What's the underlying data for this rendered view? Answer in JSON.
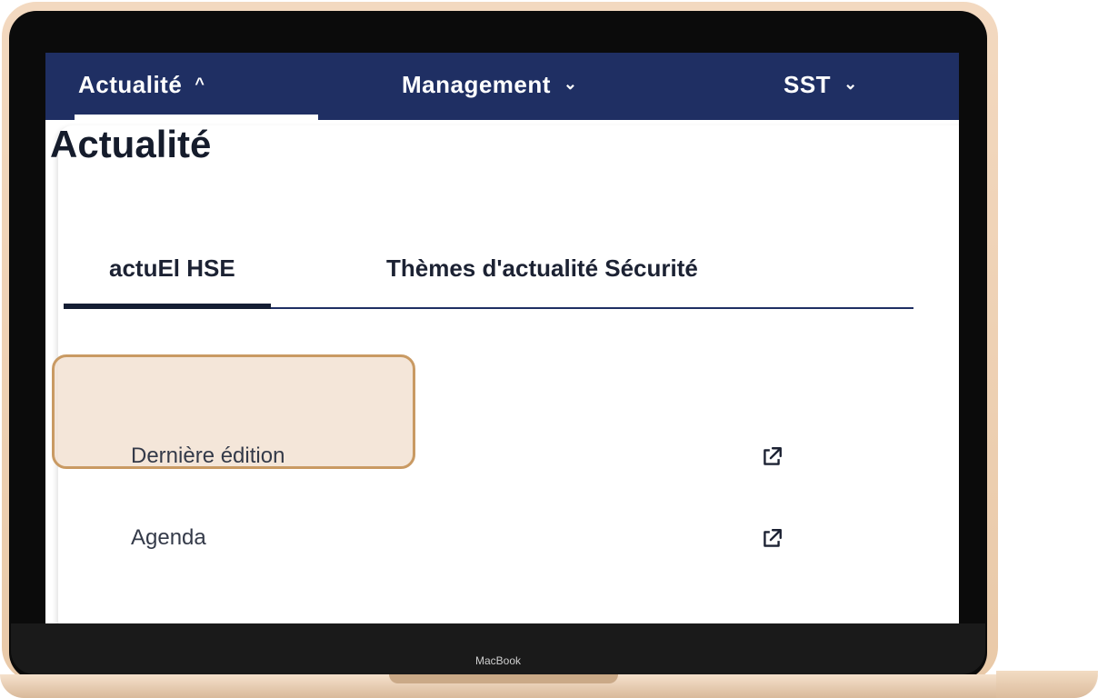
{
  "navbar": {
    "items": [
      {
        "label": "Actualité",
        "chevron": "^"
      },
      {
        "label": "Management",
        "chevron": "⌄"
      },
      {
        "label": "SST",
        "chevron": "⌄"
      }
    ]
  },
  "panel": {
    "title": "Actualité",
    "tabs": [
      {
        "label": "actuEl HSE"
      },
      {
        "label": "Thèmes d'actualité Sécurité"
      }
    ],
    "links": [
      {
        "label": "Dernière édition",
        "icon": "external-link-icon"
      },
      {
        "label": "Agenda",
        "icon": "external-link-icon"
      }
    ]
  },
  "device": {
    "brand": "MacBook"
  },
  "colors": {
    "navbar": "#1f2f63",
    "highlight_border": "#c99a63",
    "text_dark": "#151c2c"
  }
}
